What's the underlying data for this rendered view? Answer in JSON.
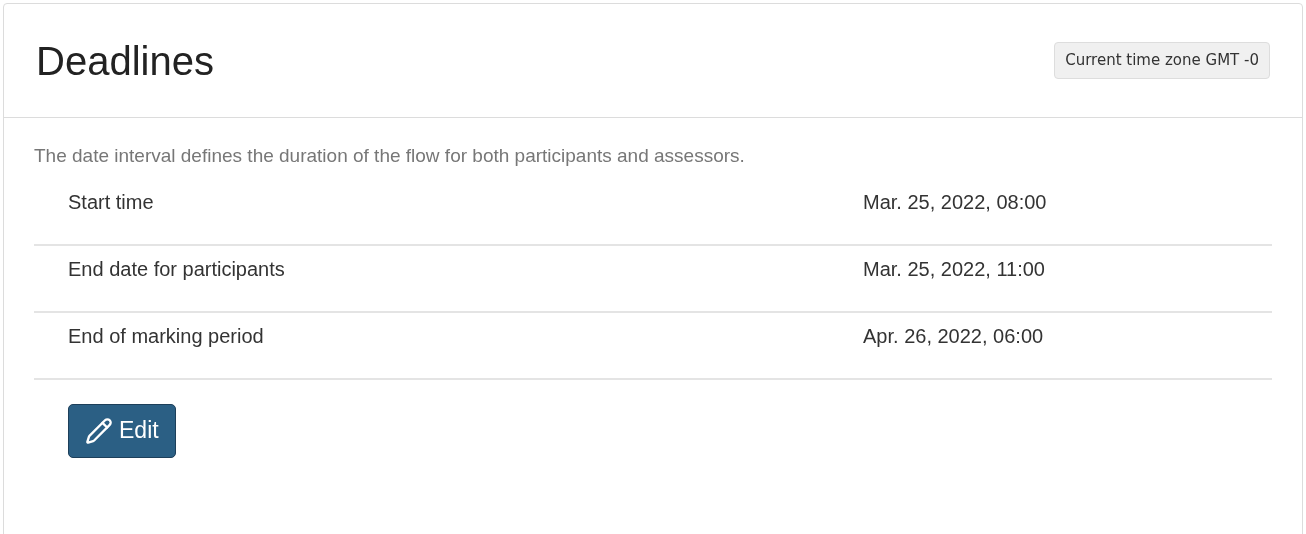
{
  "title": "Deadlines",
  "timezone_badge": "Current time zone GMT -0",
  "description": "The date interval defines the duration of the flow for both participants and assessors.",
  "rows": [
    {
      "label": "Start time",
      "value": "Mar. 25, 2022, 08:00"
    },
    {
      "label": "End date for participants",
      "value": "Mar. 25, 2022, 11:00"
    },
    {
      "label": "End of marking period",
      "value": "Apr. 26, 2022, 06:00"
    }
  ],
  "edit_button": "Edit"
}
